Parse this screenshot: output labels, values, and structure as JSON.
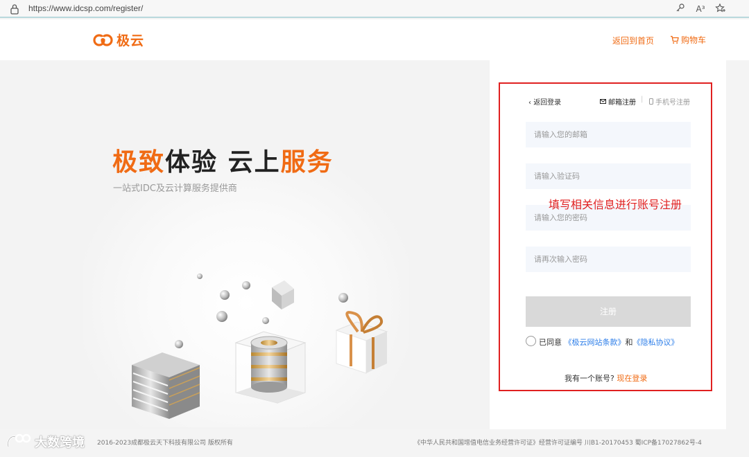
{
  "browser": {
    "url": "https://www.idcsp.com/register/",
    "icons": [
      "lock-icon",
      "key-icon",
      "read-aloud-icon",
      "favorite-icon"
    ],
    "read_aloud_label": "A³"
  },
  "header": {
    "logo_text": "极云",
    "nav_home": "返回到首页",
    "nav_cart": "购物车",
    "brand_color": "#f06b14"
  },
  "hero": {
    "title_part1": "极致",
    "title_part2": "体验",
    "title_part3": "云上",
    "title_part4": "服务",
    "subtitle": "一站式IDC及云计算服务提供商"
  },
  "form": {
    "back_login": "返回登录",
    "tab_email": "邮箱注册",
    "tab_phone": "手机号注册",
    "tab_separator": "|",
    "email_placeholder": "请输入您的邮箱",
    "code_placeholder": "请输入验证码",
    "password_placeholder": "请输入您的密码",
    "password_confirm_placeholder": "请再次输入密码",
    "submit_label": "注册",
    "agree_prefix": "已同意",
    "terms_link": "《极云网站条款》",
    "agree_and": "和",
    "privacy_link": "《隐私协议》",
    "have_account": "我有一个账号?",
    "login_now": "现在登录",
    "annotation": "填写相关信息进行账号注册",
    "annotation_color": "#e02020"
  },
  "footer": {
    "copyright": "2016-2023成都极云天下科技有限公司 版权所有",
    "license": "《中华人民共和国增值电信业务经营许可证》经营许可证编号 川B1-20170453    蜀ICP备17027862号-4",
    "watermark": "大数跨境"
  }
}
